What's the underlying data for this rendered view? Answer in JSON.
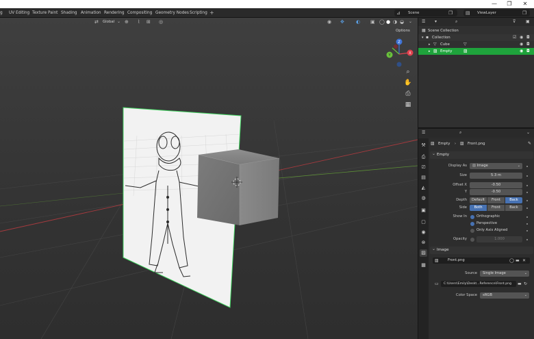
{
  "window": {
    "minimize": "—",
    "maximize": "❐",
    "close": "✕"
  },
  "workspaces": {
    "tabs": [
      "g",
      "UV Editing",
      "Texture Paint",
      "Shading",
      "Animation",
      "Rendering",
      "Compositing",
      "Geometry Nodes",
      "Scripting"
    ],
    "add": "+"
  },
  "scene": {
    "name": "Scene",
    "view_layer": "ViewLayer"
  },
  "viewport_header": {
    "transform_orientation": "Global",
    "options": "Options"
  },
  "gizmo": {
    "x": "X",
    "y": "Y",
    "z": "Z"
  },
  "outliner": {
    "rows": [
      {
        "label": "Scene Collection"
      },
      {
        "label": "Collection"
      },
      {
        "label": "Cube"
      },
      {
        "label": "Empty"
      }
    ]
  },
  "properties": {
    "breadcrumb": {
      "object": "Empty",
      "data": "Front.png"
    },
    "empty_panel": {
      "title": "Empty",
      "display_as_label": "Display As",
      "display_as_value": "Image",
      "size_label": "Size",
      "size_value": "5.3 m",
      "offset_x_label": "Offset X",
      "offset_x_value": "-0.50",
      "offset_y_label": "Y",
      "offset_y_value": "-0.50",
      "depth_label": "Depth",
      "depth_options": [
        "Default",
        "Front",
        "Back"
      ],
      "depth_selected": "Back",
      "side_label": "Side",
      "side_options": [
        "Both",
        "Front",
        "Back"
      ],
      "side_selected": "Both",
      "show_in_label": "Show In",
      "show_orthographic": "Orthographic",
      "show_perspective": "Perspective",
      "only_axis_aligned": "Only Axis Aligned",
      "opacity_label": "Opacity",
      "opacity_value": "1.000"
    },
    "image_panel": {
      "title": "Image",
      "image_name": "Front.png",
      "source_label": "Source",
      "source_value": "Single Image",
      "filepath": "C:\\Users\\Emily\\Deskt...Reference\\Front.png",
      "color_space_label": "Color Space",
      "color_space_value": "sRGB"
    }
  },
  "colors": {
    "selection_green": "#1fa33c",
    "accent_blue": "#4772b3",
    "axis_x": "#e0414e",
    "axis_y": "#6ac23c",
    "axis_z": "#3f73d6"
  }
}
